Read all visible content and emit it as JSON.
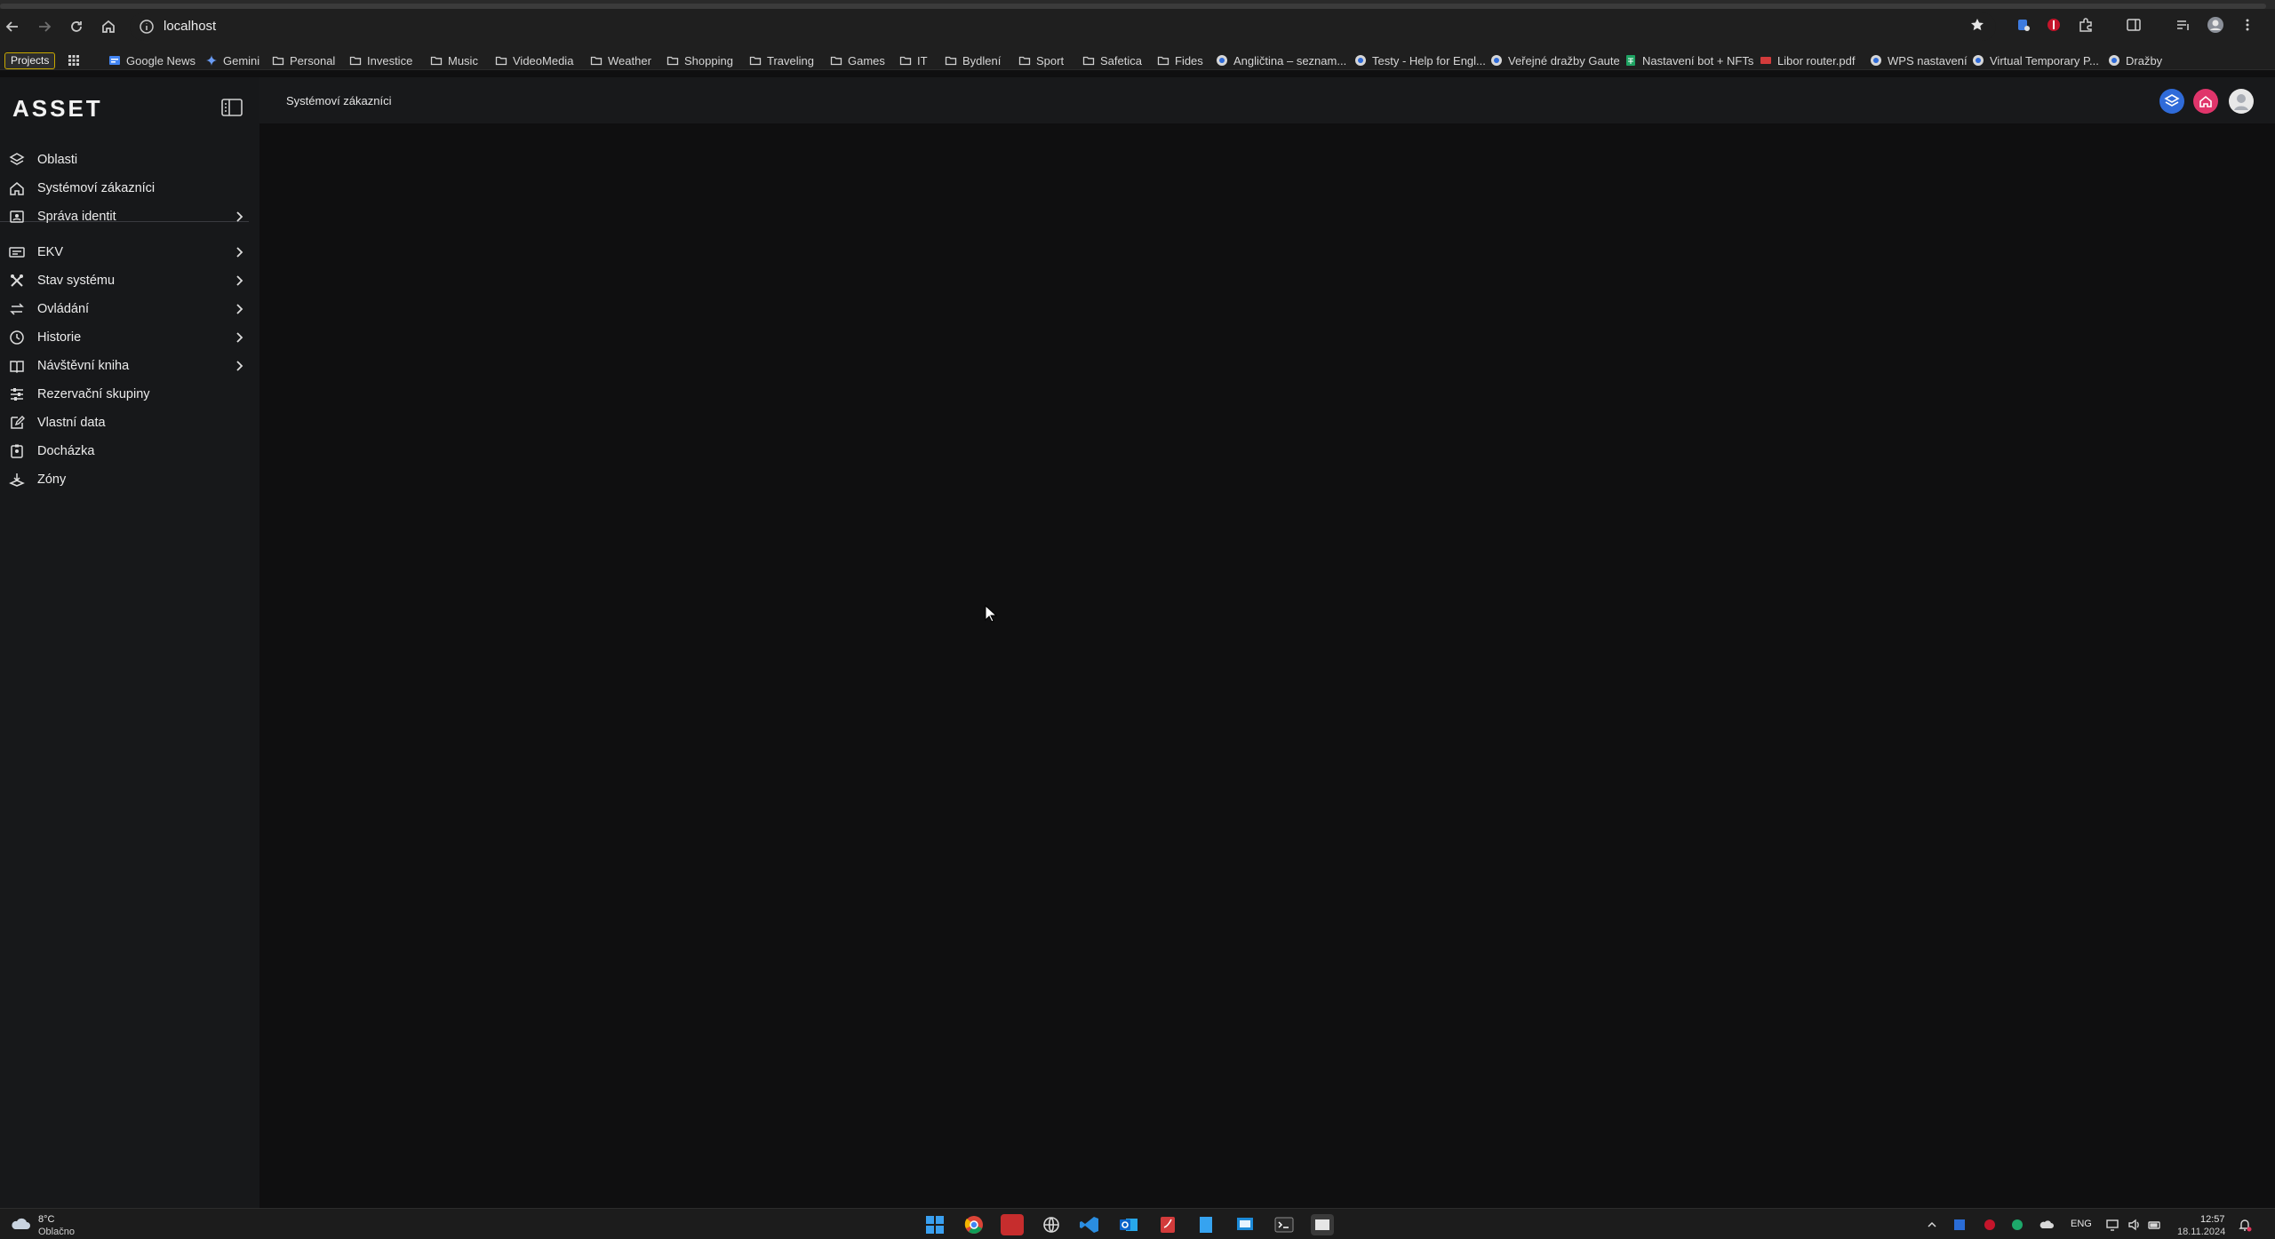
{
  "browser": {
    "url": "localhost",
    "bookmarks": {
      "projects": "Projects",
      "items": [
        {
          "label": "Google News",
          "icon": "google-news-icon"
        },
        {
          "label": "Gemini",
          "icon": "gemini-icon"
        },
        {
          "label": "Personal",
          "icon": "folder-icon"
        },
        {
          "label": "Investice",
          "icon": "folder-icon"
        },
        {
          "label": "Music",
          "icon": "folder-icon"
        },
        {
          "label": "VideoMedia",
          "icon": "folder-icon"
        },
        {
          "label": "Weather",
          "icon": "folder-icon"
        },
        {
          "label": "Shopping",
          "icon": "folder-icon"
        },
        {
          "label": "Traveling",
          "icon": "folder-icon"
        },
        {
          "label": "Games",
          "icon": "folder-icon"
        },
        {
          "label": "IT",
          "icon": "folder-icon"
        },
        {
          "label": "Bydlení",
          "icon": "folder-icon"
        },
        {
          "label": "Sport",
          "icon": "folder-icon"
        },
        {
          "label": "Safetica",
          "icon": "folder-icon"
        },
        {
          "label": "Fides",
          "icon": "folder-icon"
        },
        {
          "label": "Angličtina – seznam...",
          "icon": "site-icon"
        },
        {
          "label": "Testy - Help for Engl...",
          "icon": "site-icon"
        },
        {
          "label": "Veřejné dražby Gaute",
          "icon": "site-icon"
        },
        {
          "label": "Nastavení bot + NFTs",
          "icon": "sheets-icon"
        },
        {
          "label": "Libor router.pdf",
          "icon": "pdf-icon"
        },
        {
          "label": "WPS nastavení",
          "icon": "site-icon"
        },
        {
          "label": "Virtual Temporary P...",
          "icon": "site-icon"
        },
        {
          "label": "Dražby",
          "icon": "site-icon"
        }
      ]
    }
  },
  "app": {
    "logo_text": "ASSET",
    "header": {
      "title": "Systémoví zákazníci"
    },
    "sidebar": {
      "items": [
        {
          "label": "Oblasti",
          "icon": "layers-icon",
          "has_children": false
        },
        {
          "label": "Systémoví zákazníci",
          "icon": "home-icon",
          "has_children": false
        },
        {
          "label": "Správa identit",
          "icon": "id-card-icon",
          "has_children": true
        },
        {
          "label": "EKV",
          "icon": "card-reader-icon",
          "has_children": true
        },
        {
          "label": "Stav systému",
          "icon": "tools-icon",
          "has_children": true
        },
        {
          "label": "Ovládání",
          "icon": "arrows-icon",
          "has_children": true
        },
        {
          "label": "Historie",
          "icon": "clock-icon",
          "has_children": true
        },
        {
          "label": "Návštěvní kniha",
          "icon": "book-icon",
          "has_children": true
        },
        {
          "label": "Rezervační skupiny",
          "icon": "sliders-icon",
          "has_children": false
        },
        {
          "label": "Vlastní data",
          "icon": "edit-icon",
          "has_children": false
        },
        {
          "label": "Docházka",
          "icon": "badge-icon",
          "has_children": false
        },
        {
          "label": "Zóny",
          "icon": "zone-icon",
          "has_children": false
        }
      ]
    }
  },
  "taskbar": {
    "weather_temp": "8°C",
    "weather_desc": "Oblačno",
    "language": "ENG",
    "time": "12:57",
    "date": "18.11.2024"
  },
  "colors": {
    "accent_blue": "#2f6bd9",
    "accent_pink": "#e0356b",
    "background": "#0f0f10",
    "sidebar": "#17181a"
  }
}
